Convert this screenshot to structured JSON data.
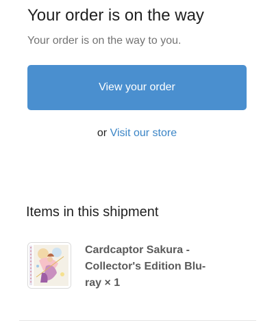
{
  "header": {
    "title": "Your order is on the way",
    "subtitle": "Your order is on the way to you."
  },
  "actions": {
    "view_order_label": "View your order",
    "or_text": "or",
    "visit_store_label": "Visit our store"
  },
  "shipment": {
    "section_title": "Items in this shipment",
    "items": [
      {
        "name": "Cardcaptor Sakura - Collector's Edition Blu-ray × 1",
        "image_icon": "product-thumbnail"
      }
    ]
  },
  "colors": {
    "button_bg": "#4a8fcf",
    "link": "#3b85c6",
    "muted_text": "#727272"
  }
}
